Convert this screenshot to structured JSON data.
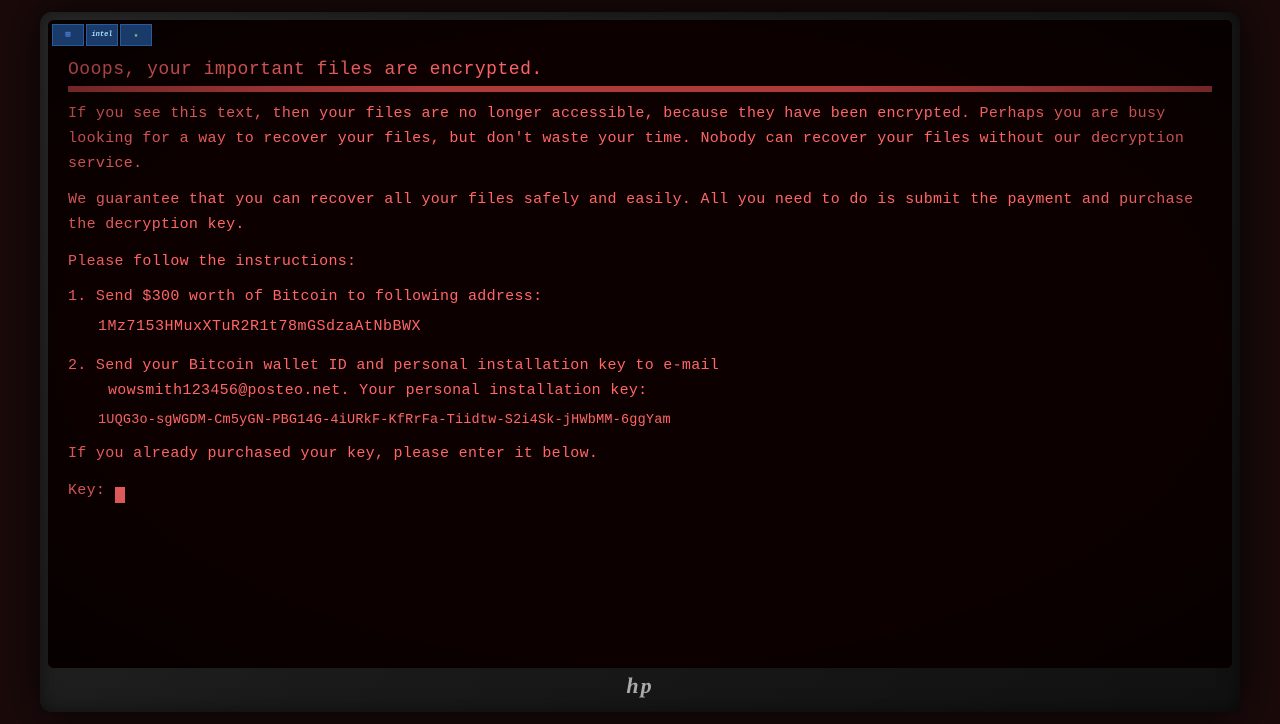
{
  "monitor": {
    "brand": "hp",
    "screen": {
      "title": "Ooops, your important files are encrypted.",
      "paragraph1": "If you see this text, then your files are no longer accessible, because they have been encrypted.  Perhaps you are busy looking for a way to recover your files, but don't waste your time.  Nobody can recover your files without our decryption service.",
      "paragraph2": "We guarantee that you can recover all your files safely and easily.  All you need to do is submit the payment and purchase the decryption key.",
      "instructions_header": "Please follow the instructions:",
      "step1_label": "1. Send $300 worth of Bitcoin to following address:",
      "bitcoin_address": "1Mz7153HMuxXTuR2R1t78mGSdzaAtNbBWX",
      "step2_label": "2. Send your Bitcoin wallet ID and personal installation key to e-mail",
      "step2_cont": "   wowsmith123456@posteo.net. Your personal installation key:",
      "personal_key": "1UQG3o-sgWGDM-Cm5yGN-PBG14G-4iURkF-KfRrFa-Tiidtw-S2i4Sk-jHWbMM-6ggYam",
      "footer_line1": "If you already purchased your key, please enter it below.",
      "footer_line2": "Key: "
    }
  },
  "taskbar_icons": [
    "Windows",
    "Intel",
    "Energy Star"
  ]
}
